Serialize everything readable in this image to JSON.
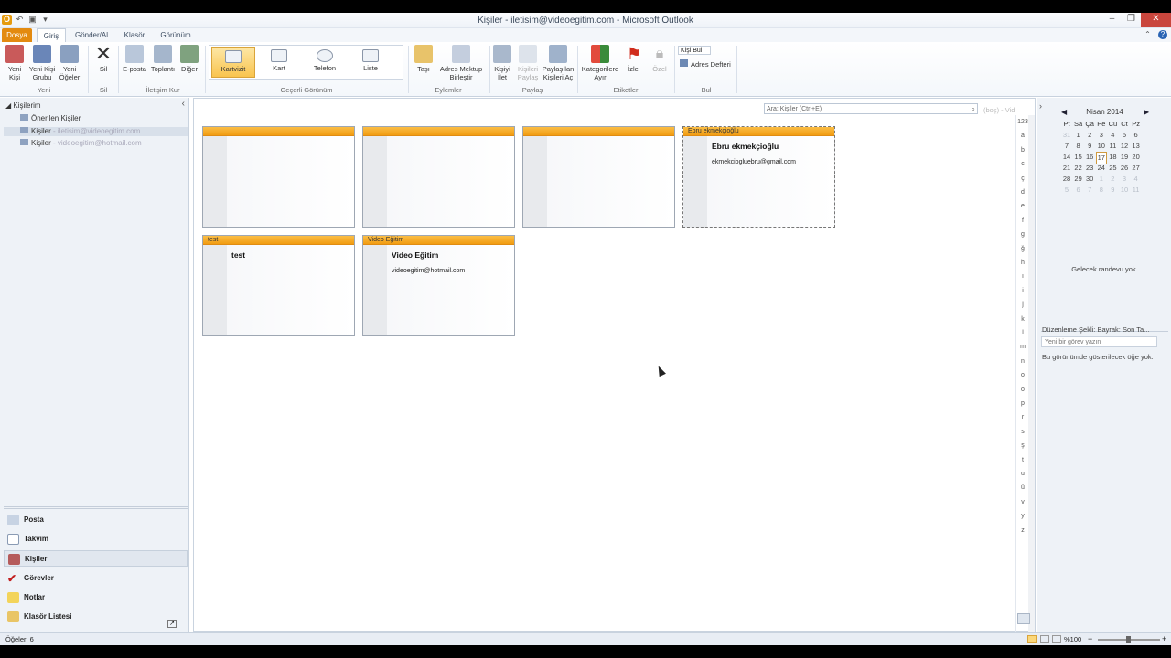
{
  "window": {
    "title": "Kişiler - iletisim@videoegitim.com - Microsoft Outlook",
    "qat_icon": "O",
    "undo": "↶",
    "save": "▣",
    "custom": "▾"
  },
  "window_controls": {
    "minimize": "–",
    "restore": "❐",
    "close": "✕"
  },
  "tabs": [
    {
      "label": "Dosya"
    },
    {
      "label": "Giriş"
    },
    {
      "label": "Gönder/Al"
    },
    {
      "label": "Klasör"
    },
    {
      "label": "Görünüm"
    }
  ],
  "ribbon_extra": {
    "minimize": "⌃",
    "help": "?"
  },
  "ribbon": {
    "new_contact": "Yeni Kişi",
    "new_group": "Yeni Kişi Grubu",
    "new_items": "Yeni Öğeler",
    "delete": "Sil",
    "email": "E-posta",
    "meeting": "Toplantı",
    "more": "Diğer",
    "view_card": "Kartvizit",
    "view_kart": "Kart",
    "view_phone": "Telefon",
    "view_list": "Liste",
    "move": "Taşı",
    "mail_merge": "Adres Mektup Birleştir",
    "forward_contact": "Kişiyi İlet",
    "share_contacts": "Kişileri Paylaş",
    "open_shared": "Paylaşılan Kişileri Aç",
    "categorize": "Kategorilere Ayır",
    "follow_up": "İzle",
    "private": "Özel",
    "find_contact": "Kişi Bul",
    "address_book": "Adres Defteri",
    "groups": {
      "new": "Yeni",
      "delete": "Sil",
      "communicate": "İletişim Kur",
      "current_view": "Geçerli Görünüm",
      "actions": "Eylemler",
      "share": "Paylaş",
      "tags": "Etiketler",
      "find": "Bul"
    }
  },
  "nav": {
    "root": "Kişilerim",
    "suggested": "Önerilen Kişiler",
    "folder1": "Kişiler",
    "folder1_sub": "- iletisim@videoegitim.com",
    "folder2": "Kişiler",
    "folder2_sub": "- videoegitim@hotmail.com",
    "collapse": "‹",
    "buttons": [
      {
        "label": "Posta"
      },
      {
        "label": "Takvim"
      },
      {
        "label": "Kişiler"
      },
      {
        "label": "Görevler"
      },
      {
        "label": "Notlar"
      },
      {
        "label": "Klasör Listesi"
      }
    ]
  },
  "search": {
    "placeholder": "Ara: Kişiler (Ctrl+E)",
    "scope": "(boş) - Vid"
  },
  "cards": [
    {
      "header": "",
      "name": "",
      "email": ""
    },
    {
      "header": "",
      "name": "",
      "email": ""
    },
    {
      "header": "",
      "name": "",
      "email": ""
    },
    {
      "header": "Ebru ekmekçioğlu",
      "name": "Ebru ekmekçioğlu",
      "email": "ekmekciogluebru@gmail.com"
    },
    {
      "header": "test",
      "name": "test",
      "email": ""
    },
    {
      "header": "Video Eğitim",
      "name": "Video Eğitim",
      "email": "videoegitim@hotmail.com"
    }
  ],
  "alphabet": [
    "123",
    "a",
    "b",
    "c",
    "ç",
    "d",
    "e",
    "f",
    "g",
    "ğ",
    "h",
    "ı",
    "i",
    "j",
    "k",
    "l",
    "m",
    "n",
    "o",
    "ö",
    "p",
    "r",
    "s",
    "ş",
    "t",
    "u",
    "ü",
    "v",
    "y",
    "z"
  ],
  "calendar": {
    "month": "Nisan 2014",
    "prev": "◀",
    "next": "▶",
    "weekdays": [
      "Pt",
      "Sa",
      "Ça",
      "Pe",
      "Cu",
      "Ct",
      "Pz"
    ],
    "weeks": [
      [
        "31",
        "1",
        "2",
        "3",
        "4",
        "5",
        "6"
      ],
      [
        "7",
        "8",
        "9",
        "10",
        "11",
        "12",
        "13"
      ],
      [
        "14",
        "15",
        "16",
        "17",
        "18",
        "19",
        "20"
      ],
      [
        "21",
        "22",
        "23",
        "24",
        "25",
        "26",
        "27"
      ],
      [
        "28",
        "29",
        "30",
        "1",
        "2",
        "3",
        "4"
      ],
      [
        "5",
        "6",
        "7",
        "8",
        "9",
        "10",
        "11"
      ]
    ]
  },
  "todo": {
    "no_appointments": "Gelecek randevu yok.",
    "arrange": "Düzenleme Şekli: Bayrak: Son Ta...",
    "task_placeholder": "Yeni bir görev yazın",
    "no_items": "Bu görünümde gösterilecek öğe yok."
  },
  "status": {
    "items": "Öğeler: 6",
    "zoom": "%100"
  }
}
